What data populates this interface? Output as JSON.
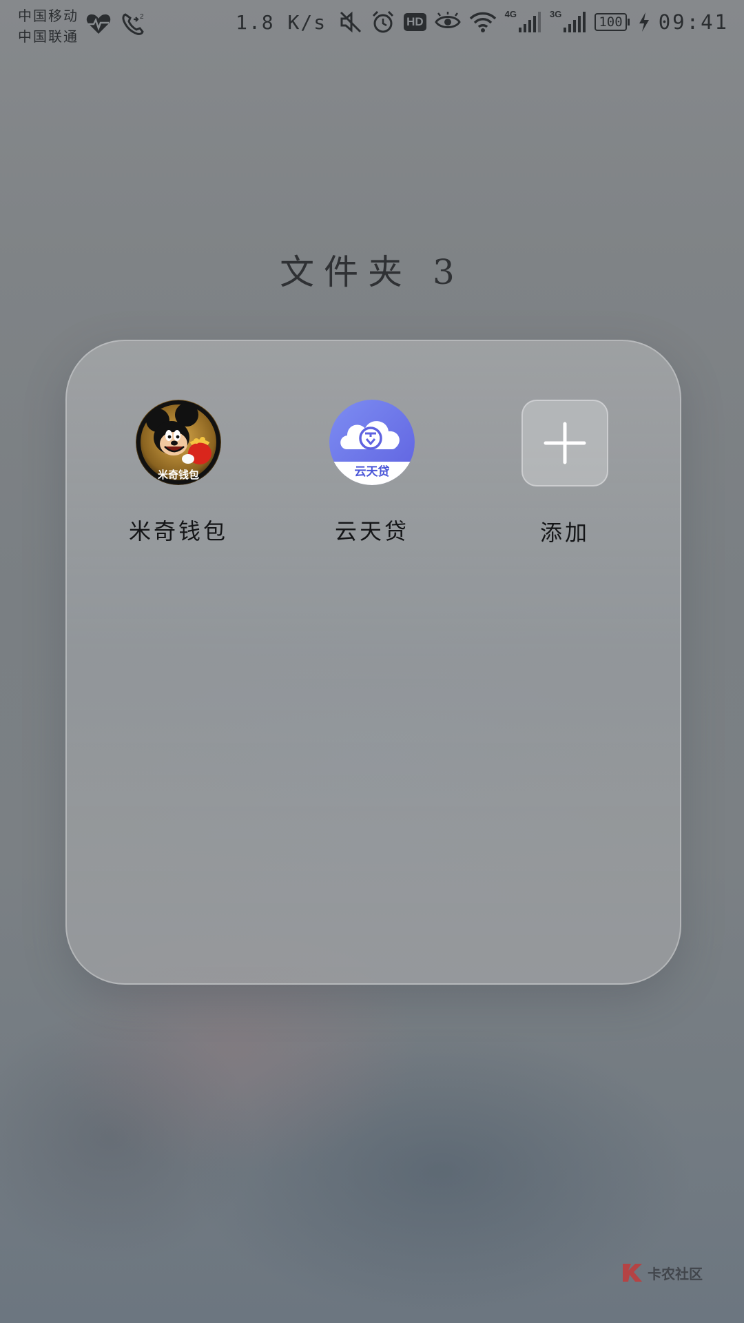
{
  "status_bar": {
    "carrier_1": "中国移动",
    "carrier_2": "中国联通",
    "net_speed": "1.8 K/s",
    "signal_1_label": "4G",
    "signal_2_label": "3G",
    "hd_badge": "HD",
    "battery": "100",
    "time": "09:41",
    "icons": [
      "heart-pulse-icon",
      "call-icon",
      "mute-icon",
      "alarm-icon",
      "hd-icon",
      "eye-comfort-icon",
      "wifi-icon",
      "signal-icon",
      "battery-icon",
      "charging-icon"
    ]
  },
  "folder": {
    "title": "文件夹 3",
    "apps": [
      {
        "label": "米奇钱包",
        "icon_text": "米奇钱包",
        "icon": "mickey-wallet-icon"
      },
      {
        "label": "云天贷",
        "icon_text": "云天贷",
        "icon": "yuntiandai-icon"
      },
      {
        "label": "添加",
        "icon": "plus-icon"
      }
    ]
  },
  "watermark": {
    "text": "卡农社区"
  },
  "colors": {
    "accent_blue": "#6f7fea",
    "mickey_red": "#d9261c",
    "mickey_gold": "#b8892e"
  }
}
